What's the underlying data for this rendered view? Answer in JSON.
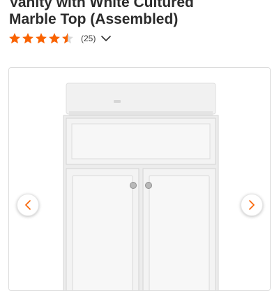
{
  "product": {
    "title_line_1": "Vanity with White Cultured",
    "title_line_2": "Marble Top (Assembled)"
  },
  "rating": {
    "stars": 4.5,
    "max_stars": 5,
    "review_count_label": "(25)"
  },
  "colors": {
    "star": "#f96302",
    "star_empty": "#d9d9d9",
    "arrow": "#f96302",
    "title": "#2b2b2b"
  },
  "icons": {
    "expand_reviews": "chevron-down-icon",
    "previous_image": "chevron-left-icon",
    "next_image": "chevron-right-icon"
  }
}
